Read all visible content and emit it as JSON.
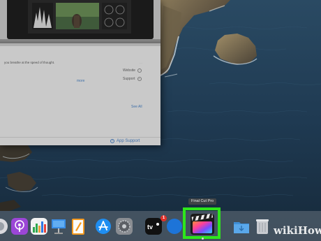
{
  "app_window": {
    "description_text": "you breathe at the speed of thought.",
    "more_link": "more",
    "website_label": "Website",
    "support_label": "Support",
    "see_all_link": "See All",
    "app_support_link": "App Support"
  },
  "dock": {
    "tooltip": "Final Cut Pro",
    "tv_badge": "1",
    "apps": [
      {
        "name": "podcasts"
      },
      {
        "name": "numbers"
      },
      {
        "name": "keynote"
      },
      {
        "name": "pages"
      },
      {
        "name": "app-store"
      },
      {
        "name": "system-preferences"
      },
      {
        "name": "apple-tv"
      },
      {
        "name": "final-cut-pro"
      },
      {
        "name": "downloads-folder"
      },
      {
        "name": "trash"
      }
    ]
  },
  "watermark": {
    "wiki": "wiki",
    "how": "How"
  },
  "colors": {
    "highlight": "#2ee61c",
    "ocean": "#1e3346",
    "link": "#3f6fa8"
  }
}
